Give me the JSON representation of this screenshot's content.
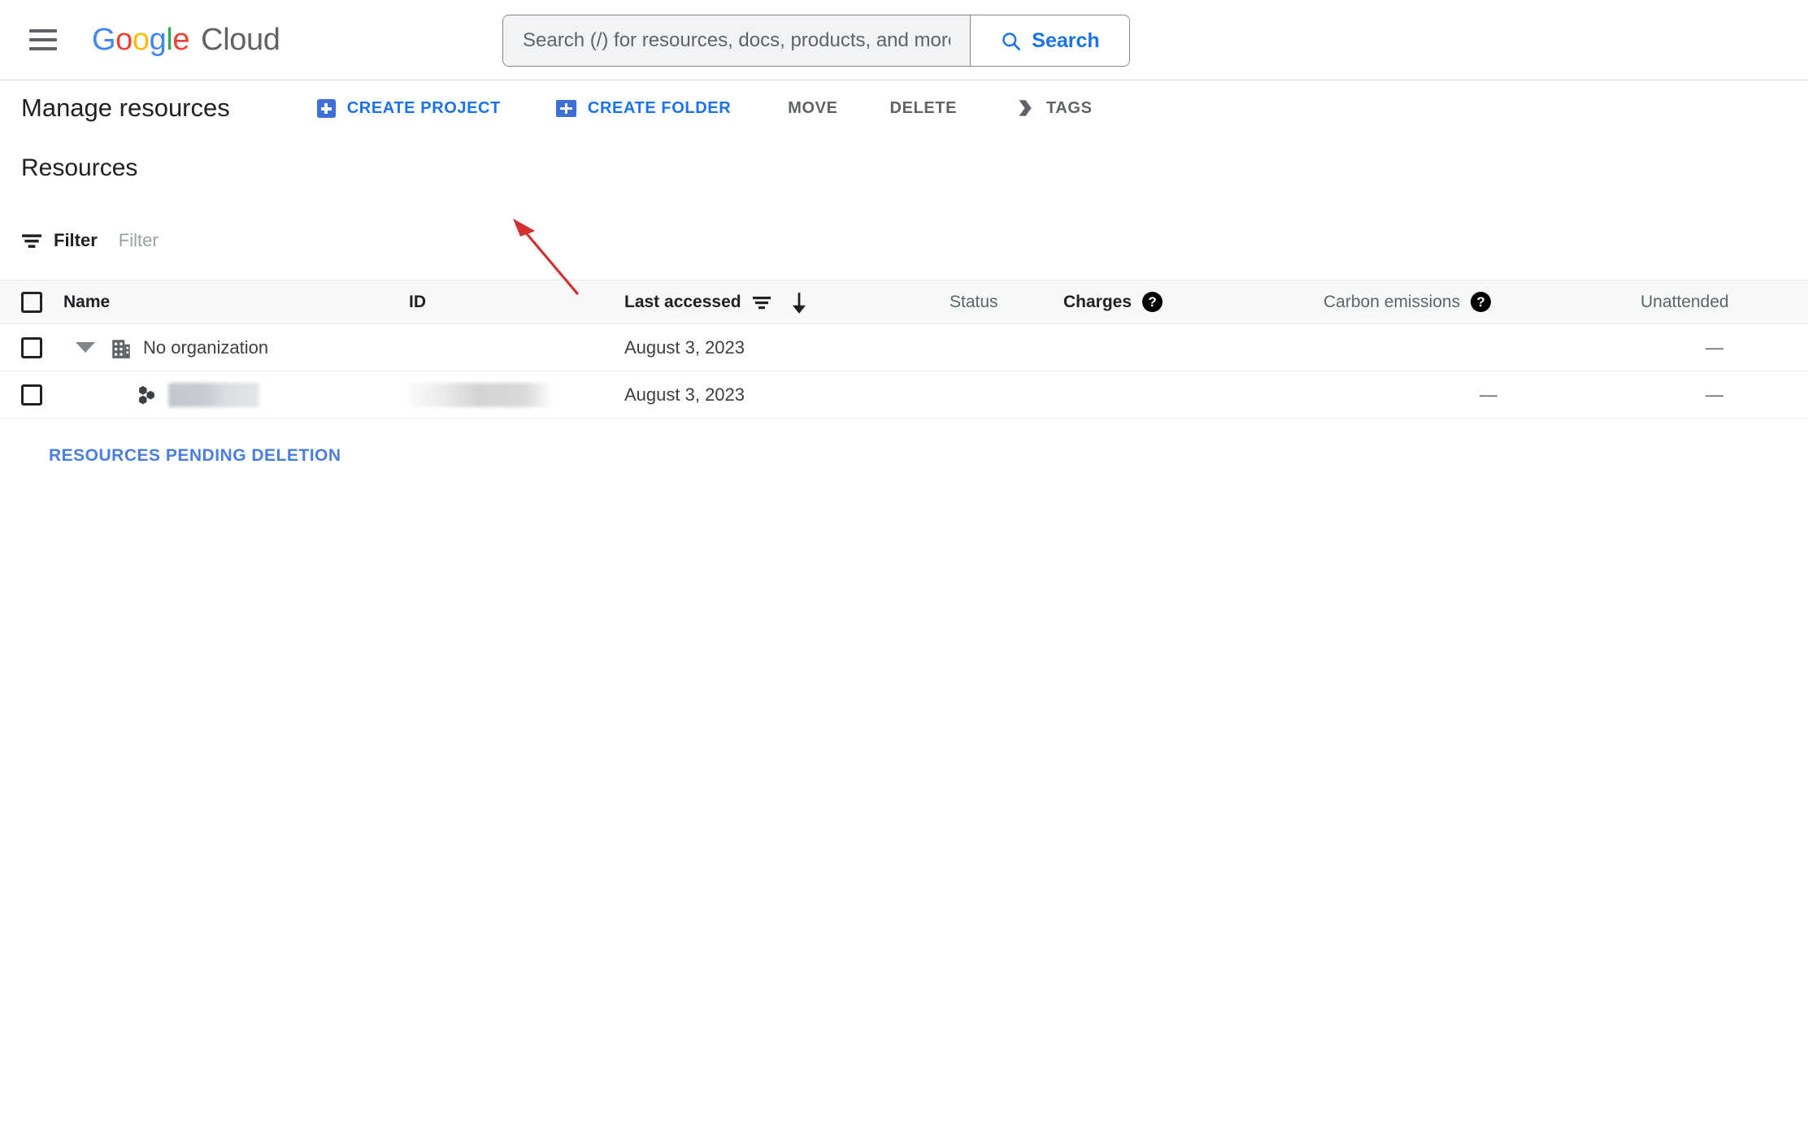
{
  "header": {
    "menu_icon": "hamburger-menu-icon",
    "brand": {
      "google": "Google",
      "cloud": "Cloud"
    },
    "search": {
      "placeholder": "Search (/) for resources, docs, products, and more",
      "value": "",
      "button_label": "Search",
      "button_icon": "search-icon"
    }
  },
  "toolbar": {
    "page_title": "Manage resources",
    "actions": [
      {
        "label": "CREATE PROJECT",
        "icon": "add-box-icon",
        "style": "blue"
      },
      {
        "label": "CREATE FOLDER",
        "icon": "create-new-folder-icon",
        "style": "blue"
      },
      {
        "label": "MOVE",
        "icon": "",
        "style": "gray"
      },
      {
        "label": "DELETE",
        "icon": "",
        "style": "gray"
      },
      {
        "label": "TAGS",
        "icon": "tag-icon",
        "style": "gray"
      }
    ]
  },
  "annotation": {
    "type": "red-arrow",
    "color": "#d32f2f",
    "points_to": "CREATE PROJECT"
  },
  "resources": {
    "section_title": "Resources",
    "filter": {
      "icon": "filter-list-icon",
      "label": "Filter",
      "placeholder": "Filter",
      "value": ""
    },
    "columns": [
      {
        "label": "Name",
        "help": false,
        "emphasis": true
      },
      {
        "label": "ID",
        "help": false,
        "emphasis": true
      },
      {
        "label": "Last accessed",
        "help": false,
        "emphasis": true,
        "sort_icon": "filter-list-icon",
        "sort_direction_icon": "arrow-downward-icon"
      },
      {
        "label": "Status",
        "help": false,
        "emphasis": false
      },
      {
        "label": "Charges",
        "help": true,
        "emphasis": true
      },
      {
        "label": "Carbon emissions",
        "help": true,
        "emphasis": false
      },
      {
        "label": "Unattended",
        "help": false,
        "emphasis": false
      }
    ],
    "rows": [
      {
        "selected": false,
        "expanded": true,
        "icon": "organization-building-icon",
        "name": "No organization",
        "name_redacted": false,
        "id": "",
        "id_redacted": false,
        "last_accessed": "August 3, 2023",
        "status": "",
        "charges": "",
        "carbon_emissions": "",
        "unattended": "—"
      },
      {
        "selected": false,
        "expanded": false,
        "icon": "project-hexagons-icon",
        "name": "",
        "name_redacted": true,
        "id": "",
        "id_redacted": true,
        "last_accessed": "August 3, 2023",
        "status": "",
        "charges": "",
        "carbon_emissions": "—",
        "unattended": "—"
      }
    ],
    "pending_deletion_link": "RESOURCES PENDING DELETION"
  },
  "colors": {
    "accent_blue": "#1a73e8",
    "link_blue": "#4a7ee0",
    "annotation_red": "#d32f2f",
    "header_band": "#f7f8f8",
    "border": "#e8eaed",
    "text_primary": "#202124",
    "text_secondary": "#5f6368"
  }
}
